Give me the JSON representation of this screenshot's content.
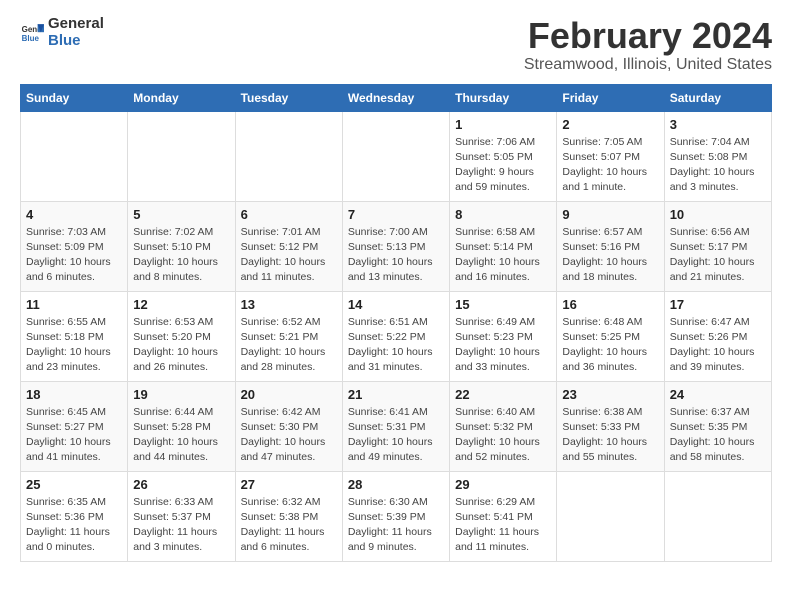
{
  "header": {
    "logo_general": "General",
    "logo_blue": "Blue",
    "title": "February 2024",
    "subtitle": "Streamwood, Illinois, United States"
  },
  "days_of_week": [
    "Sunday",
    "Monday",
    "Tuesday",
    "Wednesday",
    "Thursday",
    "Friday",
    "Saturday"
  ],
  "weeks": [
    [
      {
        "day": "",
        "info": ""
      },
      {
        "day": "",
        "info": ""
      },
      {
        "day": "",
        "info": ""
      },
      {
        "day": "",
        "info": ""
      },
      {
        "day": "1",
        "info": "Sunrise: 7:06 AM\nSunset: 5:05 PM\nDaylight: 9 hours\nand 59 minutes."
      },
      {
        "day": "2",
        "info": "Sunrise: 7:05 AM\nSunset: 5:07 PM\nDaylight: 10 hours\nand 1 minute."
      },
      {
        "day": "3",
        "info": "Sunrise: 7:04 AM\nSunset: 5:08 PM\nDaylight: 10 hours\nand 3 minutes."
      }
    ],
    [
      {
        "day": "4",
        "info": "Sunrise: 7:03 AM\nSunset: 5:09 PM\nDaylight: 10 hours\nand 6 minutes."
      },
      {
        "day": "5",
        "info": "Sunrise: 7:02 AM\nSunset: 5:10 PM\nDaylight: 10 hours\nand 8 minutes."
      },
      {
        "day": "6",
        "info": "Sunrise: 7:01 AM\nSunset: 5:12 PM\nDaylight: 10 hours\nand 11 minutes."
      },
      {
        "day": "7",
        "info": "Sunrise: 7:00 AM\nSunset: 5:13 PM\nDaylight: 10 hours\nand 13 minutes."
      },
      {
        "day": "8",
        "info": "Sunrise: 6:58 AM\nSunset: 5:14 PM\nDaylight: 10 hours\nand 16 minutes."
      },
      {
        "day": "9",
        "info": "Sunrise: 6:57 AM\nSunset: 5:16 PM\nDaylight: 10 hours\nand 18 minutes."
      },
      {
        "day": "10",
        "info": "Sunrise: 6:56 AM\nSunset: 5:17 PM\nDaylight: 10 hours\nand 21 minutes."
      }
    ],
    [
      {
        "day": "11",
        "info": "Sunrise: 6:55 AM\nSunset: 5:18 PM\nDaylight: 10 hours\nand 23 minutes."
      },
      {
        "day": "12",
        "info": "Sunrise: 6:53 AM\nSunset: 5:20 PM\nDaylight: 10 hours\nand 26 minutes."
      },
      {
        "day": "13",
        "info": "Sunrise: 6:52 AM\nSunset: 5:21 PM\nDaylight: 10 hours\nand 28 minutes."
      },
      {
        "day": "14",
        "info": "Sunrise: 6:51 AM\nSunset: 5:22 PM\nDaylight: 10 hours\nand 31 minutes."
      },
      {
        "day": "15",
        "info": "Sunrise: 6:49 AM\nSunset: 5:23 PM\nDaylight: 10 hours\nand 33 minutes."
      },
      {
        "day": "16",
        "info": "Sunrise: 6:48 AM\nSunset: 5:25 PM\nDaylight: 10 hours\nand 36 minutes."
      },
      {
        "day": "17",
        "info": "Sunrise: 6:47 AM\nSunset: 5:26 PM\nDaylight: 10 hours\nand 39 minutes."
      }
    ],
    [
      {
        "day": "18",
        "info": "Sunrise: 6:45 AM\nSunset: 5:27 PM\nDaylight: 10 hours\nand 41 minutes."
      },
      {
        "day": "19",
        "info": "Sunrise: 6:44 AM\nSunset: 5:28 PM\nDaylight: 10 hours\nand 44 minutes."
      },
      {
        "day": "20",
        "info": "Sunrise: 6:42 AM\nSunset: 5:30 PM\nDaylight: 10 hours\nand 47 minutes."
      },
      {
        "day": "21",
        "info": "Sunrise: 6:41 AM\nSunset: 5:31 PM\nDaylight: 10 hours\nand 49 minutes."
      },
      {
        "day": "22",
        "info": "Sunrise: 6:40 AM\nSunset: 5:32 PM\nDaylight: 10 hours\nand 52 minutes."
      },
      {
        "day": "23",
        "info": "Sunrise: 6:38 AM\nSunset: 5:33 PM\nDaylight: 10 hours\nand 55 minutes."
      },
      {
        "day": "24",
        "info": "Sunrise: 6:37 AM\nSunset: 5:35 PM\nDaylight: 10 hours\nand 58 minutes."
      }
    ],
    [
      {
        "day": "25",
        "info": "Sunrise: 6:35 AM\nSunset: 5:36 PM\nDaylight: 11 hours\nand 0 minutes."
      },
      {
        "day": "26",
        "info": "Sunrise: 6:33 AM\nSunset: 5:37 PM\nDaylight: 11 hours\nand 3 minutes."
      },
      {
        "day": "27",
        "info": "Sunrise: 6:32 AM\nSunset: 5:38 PM\nDaylight: 11 hours\nand 6 minutes."
      },
      {
        "day": "28",
        "info": "Sunrise: 6:30 AM\nSunset: 5:39 PM\nDaylight: 11 hours\nand 9 minutes."
      },
      {
        "day": "29",
        "info": "Sunrise: 6:29 AM\nSunset: 5:41 PM\nDaylight: 11 hours\nand 11 minutes."
      },
      {
        "day": "",
        "info": ""
      },
      {
        "day": "",
        "info": ""
      }
    ]
  ]
}
